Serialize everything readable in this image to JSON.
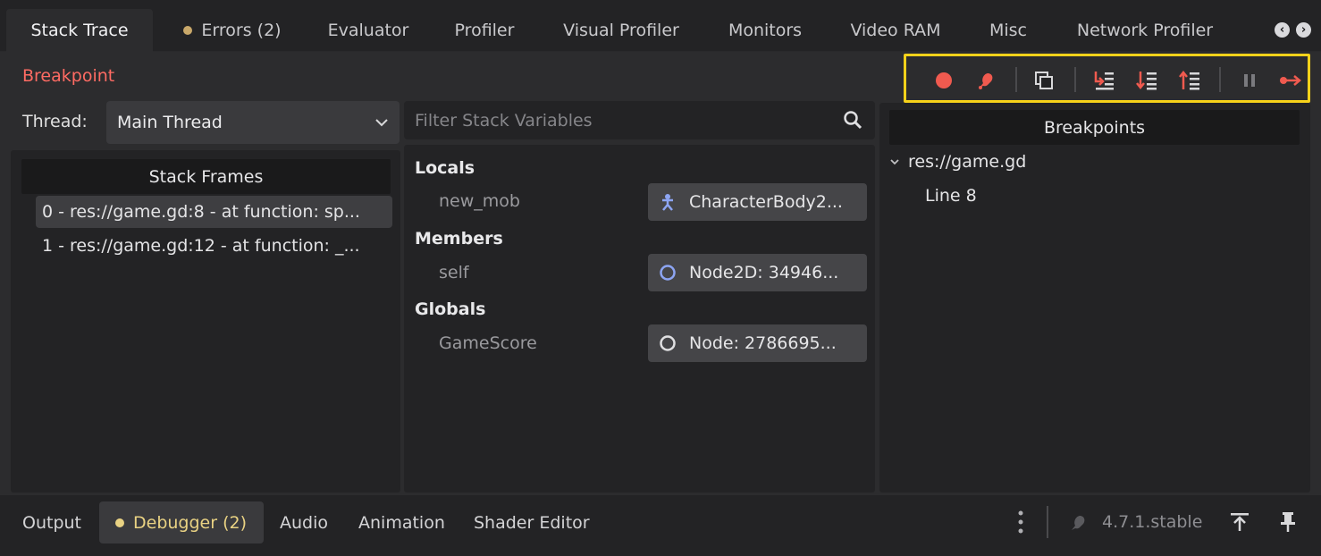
{
  "top_tabs": [
    {
      "label": "Stack Trace",
      "active": true
    },
    {
      "label": "Errors (2)",
      "dot_color": "#c9a86a"
    },
    {
      "label": "Evaluator"
    },
    {
      "label": "Profiler"
    },
    {
      "label": "Visual Profiler"
    },
    {
      "label": "Monitors"
    },
    {
      "label": "Video RAM"
    },
    {
      "label": "Misc"
    },
    {
      "label": "Network Profiler"
    }
  ],
  "status": {
    "text": "Breakpoint",
    "color": "#ff6b63"
  },
  "toolbar": {
    "buttons": [
      "record-icon",
      "bug-icon",
      "copy-icon",
      "step-into-icon",
      "step-over-icon",
      "step-out-icon",
      "pause-icon",
      "continue-icon"
    ],
    "accent": "#f05a4f",
    "highlight": "#f7d21a"
  },
  "thread": {
    "label": "Thread:",
    "value": "Main Thread"
  },
  "stack_frames": {
    "header": "Stack Frames",
    "items": [
      "0 - res://game.gd:8 - at function: sp...",
      "1 - res://game.gd:12 - at function: _..."
    ]
  },
  "filter": {
    "placeholder": "Filter Stack Variables"
  },
  "variables": {
    "locals": {
      "label": "Locals",
      "name": "new_mob",
      "value": "CharacterBody2..."
    },
    "members": {
      "label": "Members",
      "name": "self",
      "value": "Node2D: 34946..."
    },
    "globals": {
      "label": "Globals",
      "name": "GameScore",
      "value": "Node: 2786695..."
    }
  },
  "breakpoints": {
    "header": "Breakpoints",
    "file": "res://game.gd",
    "line": "Line 8"
  },
  "bottom_tabs": [
    {
      "label": "Output"
    },
    {
      "label": "Debugger (2)",
      "active": true,
      "dot_color": "#e9d283"
    },
    {
      "label": "Audio"
    },
    {
      "label": "Animation"
    },
    {
      "label": "Shader Editor"
    }
  ],
  "version": "4.7.1.stable"
}
